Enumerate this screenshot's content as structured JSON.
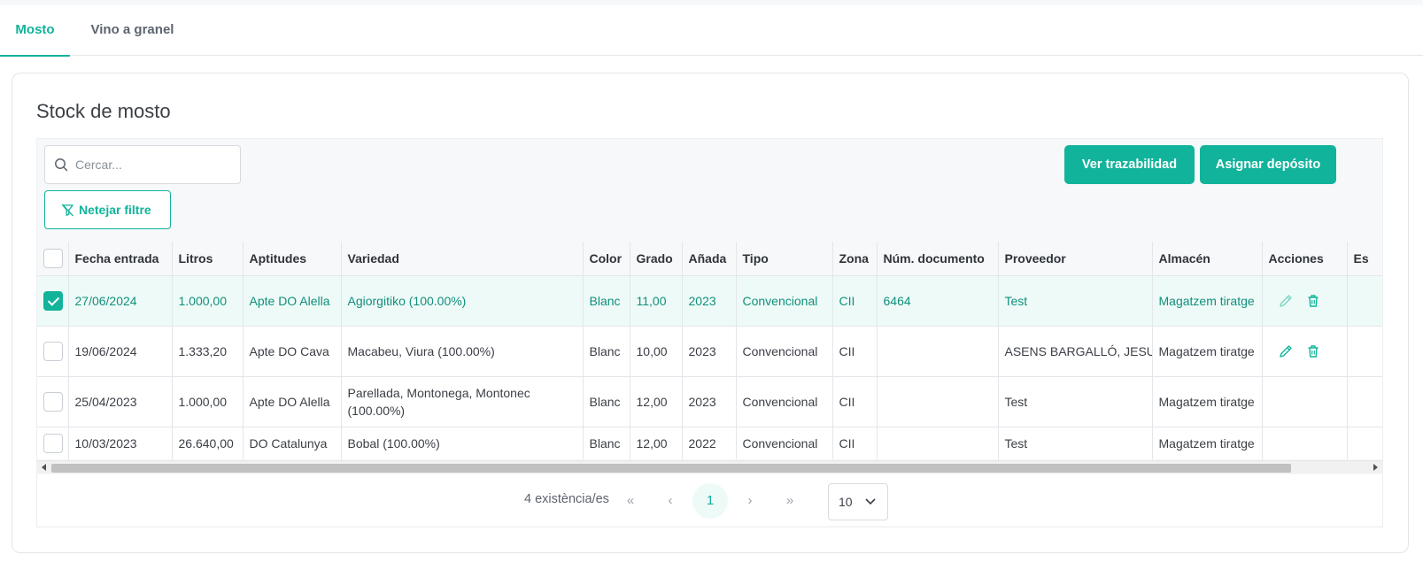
{
  "tabs": [
    {
      "label": "Mosto",
      "active": true
    },
    {
      "label": "Vino a granel",
      "active": false
    }
  ],
  "card": {
    "title": "Stock de mosto"
  },
  "search": {
    "placeholder": "Cercar..."
  },
  "filters": {
    "clear_label": "Netejar filtre"
  },
  "toolbar": {
    "traceability_label": "Ver trazabilidad",
    "assign_label": "Asignar depósito"
  },
  "colors": {
    "accent": "#12b39b",
    "selected_row": "#eefaf7"
  },
  "table": {
    "columns": [
      "Fecha entrada",
      "Litros",
      "Aptitudes",
      "Variedad",
      "Color",
      "Grado",
      "Añada",
      "Tipo",
      "Zona",
      "Núm. documento",
      "Proveedor",
      "Almacén",
      "Acciones",
      "Es"
    ],
    "rows": [
      {
        "selected": true,
        "actions": true,
        "cells": [
          "27/06/2024",
          "1.000,00",
          "Apte DO Alella",
          "Agiorgitiko (100.00%)",
          "Blanc",
          "11,00",
          "2023",
          "Convencional",
          "CII",
          "6464",
          "Test",
          "Magatzem tiratge"
        ]
      },
      {
        "selected": false,
        "actions": true,
        "cells": [
          "19/06/2024",
          "1.333,20",
          "Apte DO Cava",
          "Macabeu, Viura (100.00%)",
          "Blanc",
          "10,00",
          "2023",
          "Convencional",
          "CII",
          "",
          "ASENS BARGALLÓ, JESUS",
          "Magatzem tiratge"
        ]
      },
      {
        "selected": false,
        "actions": false,
        "cells": [
          "25/04/2023",
          "1.000,00",
          "Apte DO Alella",
          "Parellada, Montonega, Montonec (100.00%)",
          "Blanc",
          "12,00",
          "2023",
          "Convencional",
          "CII",
          "",
          "Test",
          "Magatzem tiratge"
        ]
      },
      {
        "selected": false,
        "actions": false,
        "cells": [
          "10/03/2023",
          "26.640,00",
          "DO Catalunya",
          "Bobal (100.00%)",
          "Blanc",
          "12,00",
          "2022",
          "Convencional",
          "CII",
          "",
          "Test",
          "Magatzem tiratge"
        ]
      }
    ]
  },
  "pagination": {
    "count_label": "4 existència/es",
    "first": "«",
    "prev": "‹",
    "current_page": "1",
    "next": "›",
    "last": "»",
    "page_size": "10"
  },
  "icons": {
    "search": "search-icon",
    "filter_clear": "filter-off-icon",
    "edit": "pencil-icon",
    "delete": "trash-icon",
    "page_size_arrow": "chevron-down-icon"
  }
}
